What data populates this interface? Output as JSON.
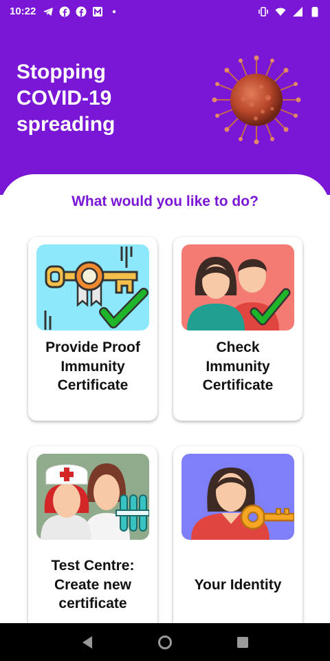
{
  "status_bar": {
    "time": "10:22",
    "left_icons": [
      "telegram-icon",
      "facebook-icon",
      "facebook-icon",
      "app-icon",
      "dot-icon"
    ],
    "right_icons": [
      "vibrate-icon",
      "wifi-icon",
      "signal-icon",
      "battery-icon"
    ]
  },
  "header": {
    "title_lines": [
      "Stopping",
      "COVID-19",
      "spreading"
    ],
    "background": "#7a17d6",
    "image": "virus-icon"
  },
  "main": {
    "question": "What would you like to do?",
    "accent": "#7a17d6",
    "tiles": [
      {
        "lines": [
          "Provide Proof",
          "Immunity",
          "Certificate"
        ],
        "image": "key-certificate-icon",
        "image_bg": "#8ee8fb"
      },
      {
        "lines": [
          "Check",
          "Immunity",
          "Certificate"
        ],
        "image": "people-check-icon",
        "image_bg": "#f47a74"
      },
      {
        "lines": [
          "Test Centre:",
          "Create new",
          "certificate"
        ],
        "image": "nurse-doctor-icon",
        "image_bg": "#8fab8c"
      },
      {
        "lines": [
          "Your Identity"
        ],
        "image": "person-key-icon",
        "image_bg": "#7f7ffa"
      }
    ]
  },
  "nav_bar": {
    "buttons": [
      "back-icon",
      "home-icon",
      "recents-icon"
    ]
  }
}
